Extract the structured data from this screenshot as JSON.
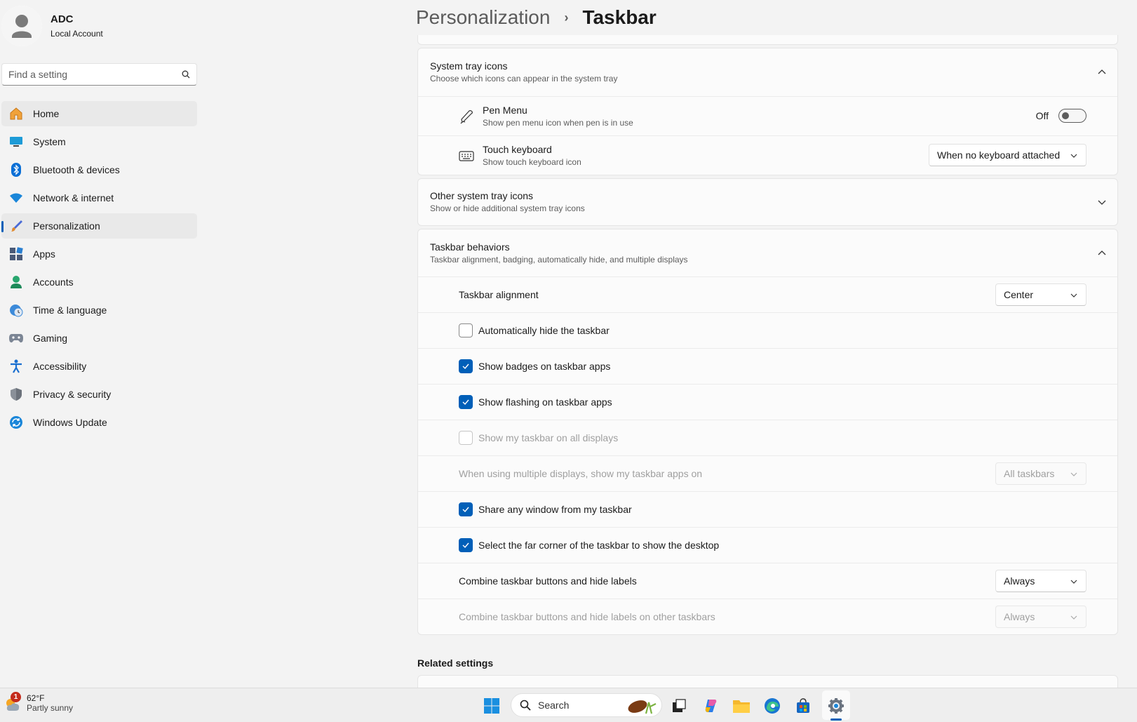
{
  "profile": {
    "name": "ADC",
    "account_type": "Local Account"
  },
  "search": {
    "placeholder": "Find a setting"
  },
  "nav": {
    "items": [
      {
        "label": "Home",
        "icon": "home-icon"
      },
      {
        "label": "System",
        "icon": "system-icon"
      },
      {
        "label": "Bluetooth & devices",
        "icon": "bluetooth-icon"
      },
      {
        "label": "Network & internet",
        "icon": "wifi-icon"
      },
      {
        "label": "Personalization",
        "icon": "brush-icon",
        "selected": true
      },
      {
        "label": "Apps",
        "icon": "apps-icon"
      },
      {
        "label": "Accounts",
        "icon": "accounts-icon"
      },
      {
        "label": "Time & language",
        "icon": "clock-icon"
      },
      {
        "label": "Gaming",
        "icon": "gamepad-icon"
      },
      {
        "label": "Accessibility",
        "icon": "accessibility-icon"
      },
      {
        "label": "Privacy & security",
        "icon": "shield-icon"
      },
      {
        "label": "Windows Update",
        "icon": "update-icon"
      }
    ]
  },
  "header": {
    "parent": "Personalization",
    "separator": "›",
    "current": "Taskbar"
  },
  "system_tray": {
    "title": "System tray icons",
    "subtitle": "Choose which icons can appear in the system tray",
    "pen_menu": {
      "title": "Pen Menu",
      "subtitle": "Show pen menu icon when pen is in use",
      "state_label": "Off"
    },
    "touch_keyboard": {
      "title": "Touch keyboard",
      "subtitle": "Show touch keyboard icon",
      "value": "When no keyboard attached"
    }
  },
  "other_tray": {
    "title": "Other system tray icons",
    "subtitle": "Show or hide additional system tray icons"
  },
  "behaviors": {
    "title": "Taskbar behaviors",
    "subtitle": "Taskbar alignment, badging, automatically hide, and multiple displays",
    "alignment": {
      "label": "Taskbar alignment",
      "value": "Center"
    },
    "auto_hide": {
      "label": "Automatically hide the taskbar",
      "checked": false
    },
    "badges": {
      "label": "Show badges on taskbar apps",
      "checked": true
    },
    "flashing": {
      "label": "Show flashing on taskbar apps",
      "checked": true
    },
    "all_displays": {
      "label": "Show my taskbar on all displays",
      "checked": false,
      "disabled": true
    },
    "multi_display_apps": {
      "label": "When using multiple displays, show my taskbar apps on",
      "value": "All taskbars",
      "disabled": true
    },
    "share_window": {
      "label": "Share any window from my taskbar",
      "checked": true
    },
    "far_corner": {
      "label": "Select the far corner of the taskbar to show the desktop",
      "checked": true
    },
    "combine": {
      "label": "Combine taskbar buttons and hide labels",
      "value": "Always"
    },
    "combine_other": {
      "label": "Combine taskbar buttons and hide labels on other taskbars",
      "value": "Always",
      "disabled": true
    }
  },
  "related": {
    "title": "Related settings"
  },
  "taskbar": {
    "weather": {
      "temp": "62°F",
      "desc": "Partly sunny",
      "badge": "1"
    },
    "search_label": "Search",
    "colors": {
      "accent": "#005fb8",
      "badge": "#c42b1c"
    }
  }
}
